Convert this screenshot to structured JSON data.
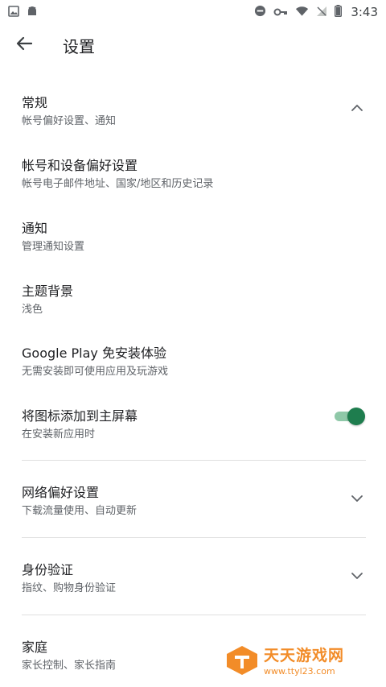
{
  "status_bar": {
    "time": "3:43",
    "icons_left": [
      "image-icon",
      "android-icon"
    ],
    "icons_right": [
      "do-not-disturb-icon",
      "key-icon",
      "wifi-icon",
      "no-signal-icon",
      "battery-icon"
    ]
  },
  "app_bar": {
    "title": "设置",
    "back_icon": "arrow-back-icon"
  },
  "settings": {
    "general": {
      "title": "常规",
      "subtitle": "帐号偏好设置、通知",
      "expanded": true
    },
    "account": {
      "title": "帐号和设备偏好设置",
      "subtitle": "帐号电子邮件地址、国家/地区和历史记录"
    },
    "notifications": {
      "title": "通知",
      "subtitle": "管理通知设置"
    },
    "theme": {
      "title": "主题背景",
      "subtitle": "浅色"
    },
    "instant": {
      "title": "Google Play 免安装体验",
      "subtitle": "无需安装即可使用应用及玩游戏"
    },
    "add_icon": {
      "title": "将图标添加到主屏幕",
      "subtitle": "在安装新应用时",
      "enabled": true
    },
    "network": {
      "title": "网络偏好设置",
      "subtitle": "下载流量使用、自动更新",
      "expanded": false
    },
    "auth": {
      "title": "身份验证",
      "subtitle": "指纹、购物身份验证",
      "expanded": false
    },
    "family": {
      "title": "家庭",
      "subtitle": "家长控制、家长指南"
    }
  },
  "colors": {
    "toggle_on": "#1e7d4e",
    "toggle_track": "#8fc8a8",
    "watermark": "#f28c28"
  },
  "watermark": {
    "name": "天天游戏网",
    "url": "www.ttyl23.com"
  }
}
